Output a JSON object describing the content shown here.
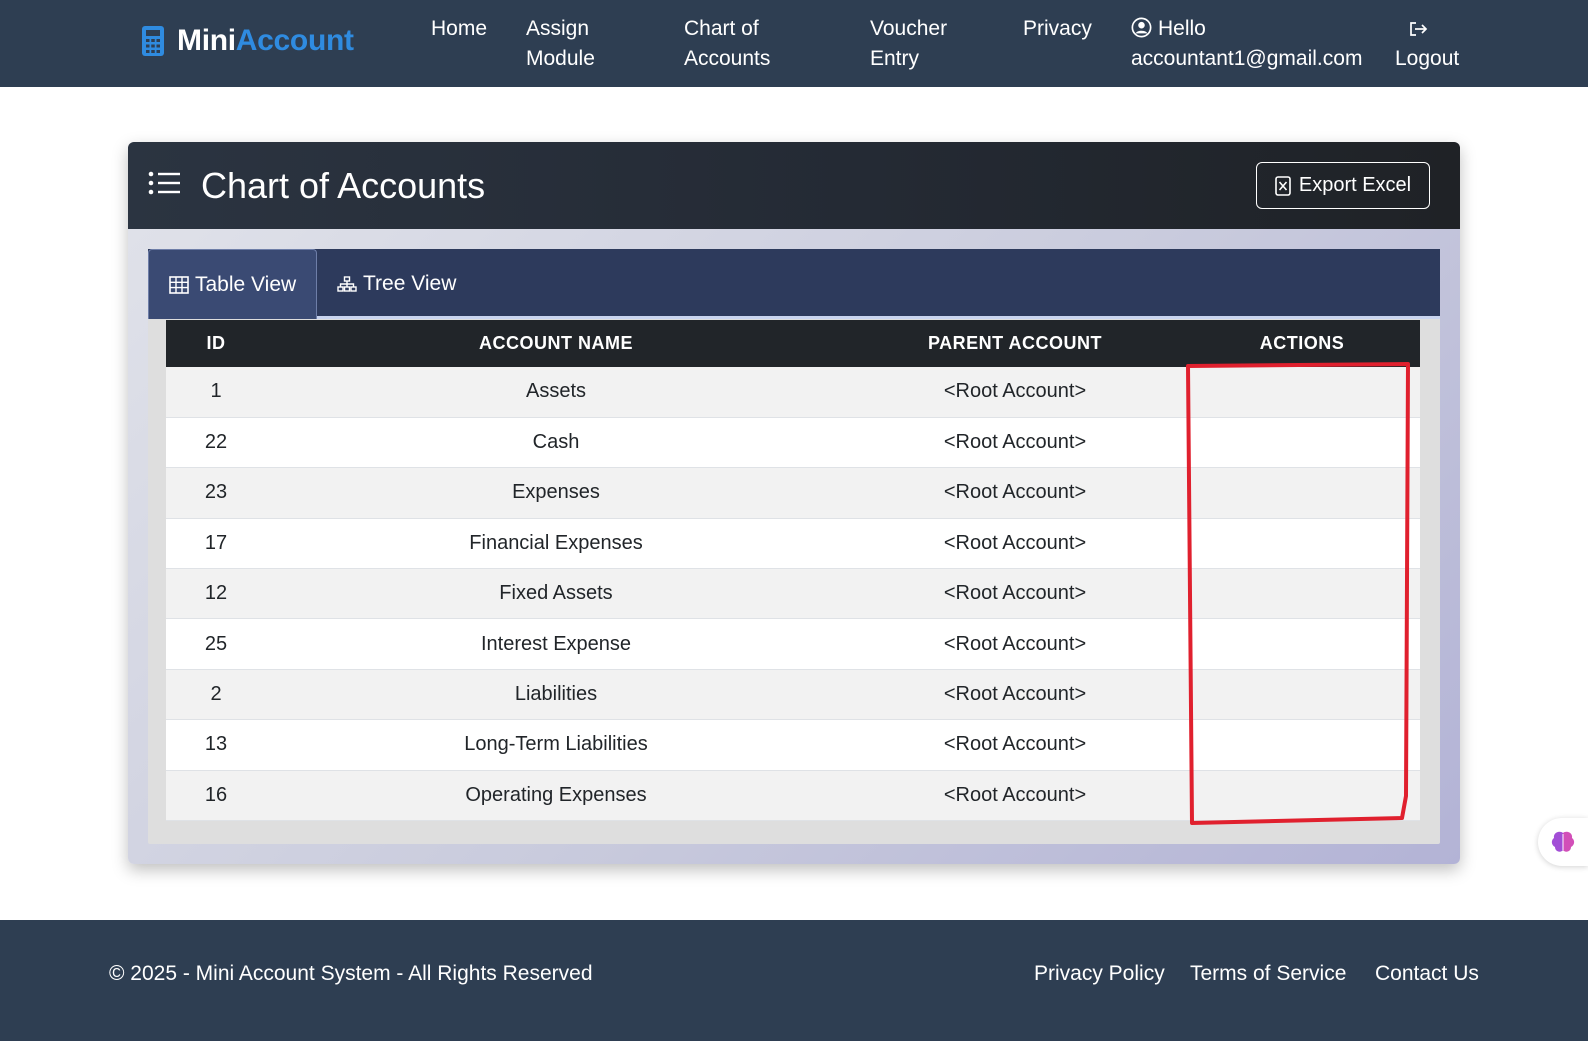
{
  "navbar": {
    "brand_part1": "Mini",
    "brand_part2": "Account",
    "brand_icon": "calculator-icon",
    "links": [
      "Home",
      "Assign",
      "Module",
      "Chart of",
      "Accounts",
      "Voucher",
      "Entry",
      "Privacy"
    ],
    "user_hello": "Hello",
    "user_email": "accountant1@gmail.com",
    "logout": "Logout",
    "colors": {
      "bg": "#2e3e52",
      "brand_accent": "#2f8be0"
    }
  },
  "card": {
    "title": "Chart of Accounts",
    "title_icon": "list-icon",
    "export_label": "Export Excel",
    "export_icon": "excel-file-icon"
  },
  "tabs": {
    "table_view": "Table View",
    "tree_view": "Tree View",
    "active": "Table View"
  },
  "table": {
    "headers": [
      "ID",
      "ACCOUNT NAME",
      "PARENT ACCOUNT",
      "ACTIONS"
    ],
    "rows": [
      {
        "id": "1",
        "name": "Assets",
        "parent": "<Root Account>",
        "actions": ""
      },
      {
        "id": "22",
        "name": "Cash",
        "parent": "<Root Account>",
        "actions": ""
      },
      {
        "id": "23",
        "name": "Expenses",
        "parent": "<Root Account>",
        "actions": ""
      },
      {
        "id": "17",
        "name": "Financial Expenses",
        "parent": "<Root Account>",
        "actions": ""
      },
      {
        "id": "12",
        "name": "Fixed Assets",
        "parent": "<Root Account>",
        "actions": ""
      },
      {
        "id": "25",
        "name": "Interest Expense",
        "parent": "<Root Account>",
        "actions": ""
      },
      {
        "id": "2",
        "name": "Liabilities",
        "parent": "<Root Account>",
        "actions": ""
      },
      {
        "id": "13",
        "name": "Long-Term Liabilities",
        "parent": "<Root Account>",
        "actions": ""
      },
      {
        "id": "16",
        "name": "Operating Expenses",
        "parent": "<Root Account>",
        "actions": ""
      }
    ]
  },
  "annotation": {
    "color": "#e0202e",
    "target": "ACTIONS"
  },
  "footer": {
    "copyright": "© 2025 - Mini Account System - All Rights Reserved",
    "links": [
      "Privacy Policy",
      "Terms of Service",
      "Contact Us"
    ]
  }
}
